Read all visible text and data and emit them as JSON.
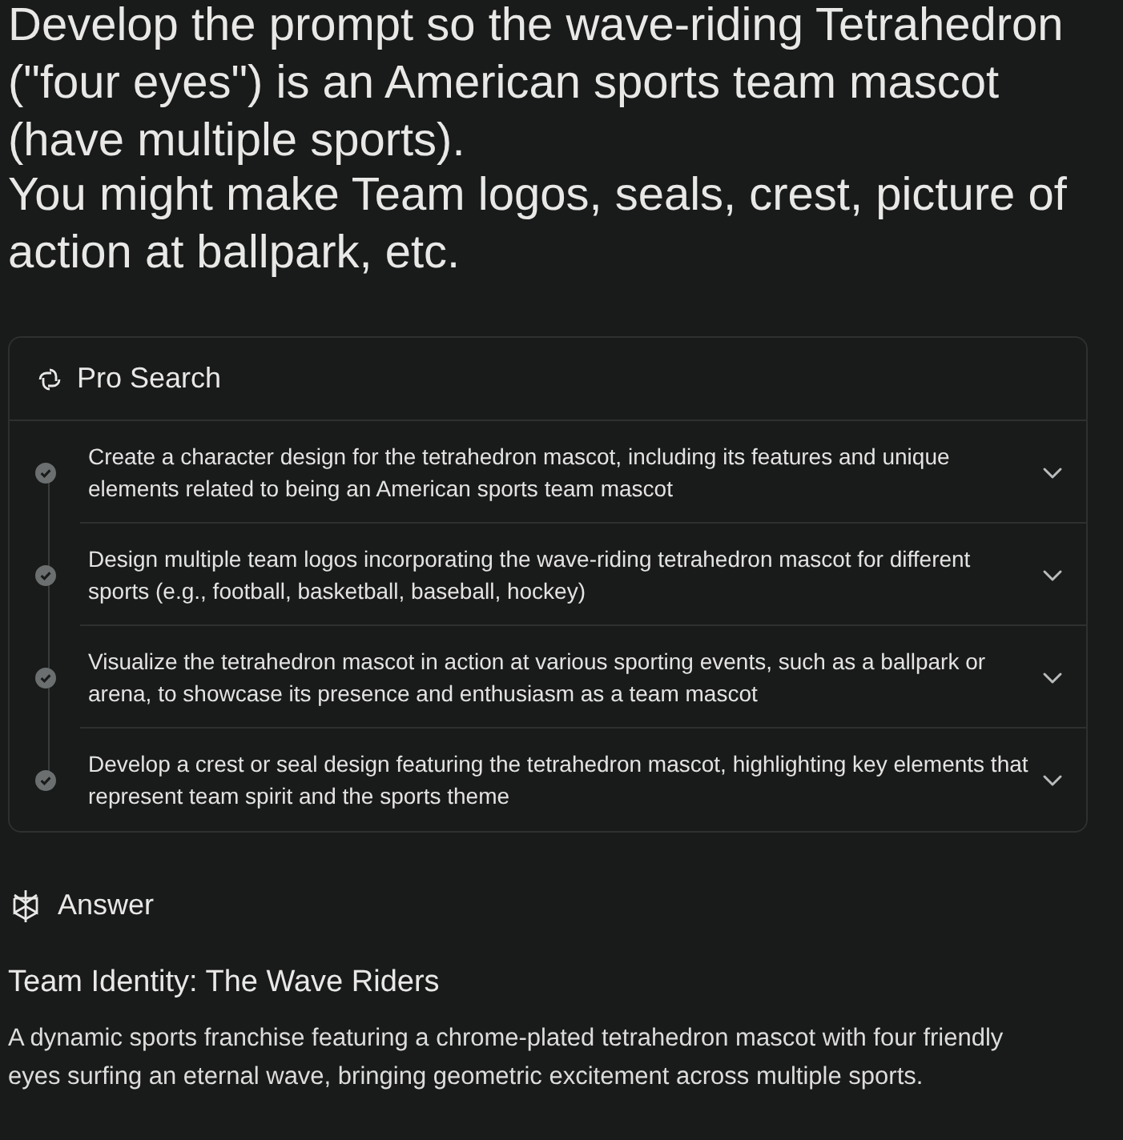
{
  "query": [
    "Develop the prompt so the wave-riding Tetrahedron (\"four eyes\") is an American sports team mascot (have multiple sports).",
    "You might make Team logos, seals, crest, picture of action at ballpark, etc."
  ],
  "pro_search": {
    "title": "Pro Search",
    "steps": [
      {
        "text": "Create a character design for the tetrahedron mascot, including its features and unique elements related to being an American sports team mascot",
        "done": true,
        "expanded": false
      },
      {
        "text": "Design multiple team logos incorporating the wave-riding tetrahedron mascot for different sports (e.g., football, basketball, baseball, hockey)",
        "done": true,
        "expanded": false
      },
      {
        "text": "Visualize the tetrahedron mascot in action at various sporting events, such as a ballpark or arena, to showcase its presence and enthusiasm as a team mascot",
        "done": true,
        "expanded": false
      },
      {
        "text": "Develop a crest or seal design featuring the tetrahedron mascot, highlighting key elements that represent team spirit and the sports theme",
        "done": true,
        "expanded": false
      }
    ]
  },
  "answer": {
    "label": "Answer",
    "heading": "Team Identity: The Wave Riders",
    "body": "A dynamic sports franchise featuring a chrome-plated tetrahedron mascot with four friendly eyes surfing an eternal wave, bringing geometric excitement across multiple sports."
  }
}
